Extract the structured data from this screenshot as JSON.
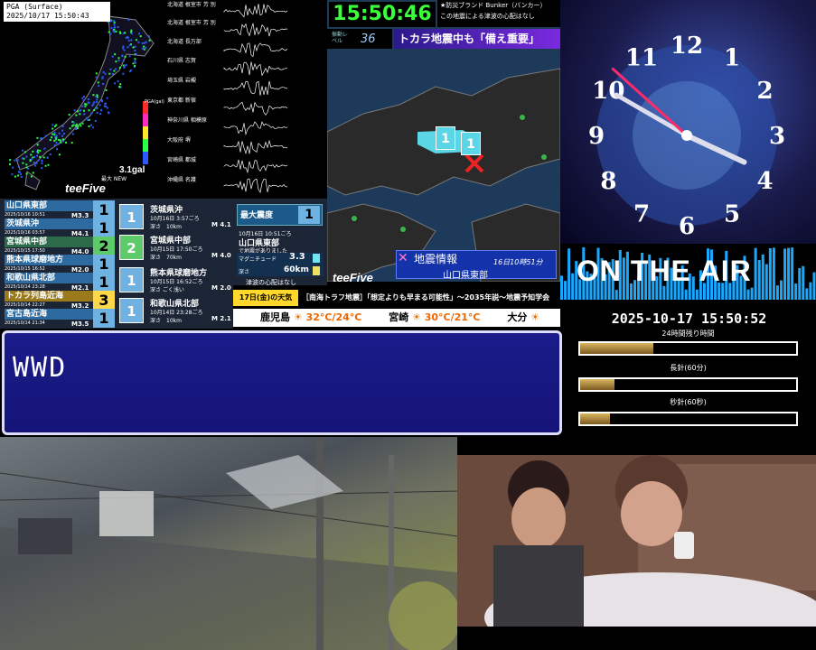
{
  "seismo": {
    "title_line1": "PGA (Surface)",
    "title_line2": "2025/10/17 15:50:43",
    "pga_value": "3.1gal",
    "peak_label": "最大 NEW",
    "pga_unit": "PGA(gal)",
    "brand": "teeFive",
    "stations": [
      "北海道 根室市 芳 別",
      "北海道 根室市 芳 別",
      "北海道 長万部",
      "石川県 志賀",
      "埼玉県 岩槻",
      "東京都 新宿",
      "神奈川県 相模原",
      "大阪府 堺",
      "宮崎県 都城",
      "沖縄県 名護"
    ]
  },
  "clock_digital": "15:50:46",
  "bunker": {
    "line1": "★防災ブランド Bunker（バンカー）",
    "line2": "この地震による津波の心配はなし"
  },
  "level": {
    "label": "振動レベル",
    "value": "36"
  },
  "headline": "トカラ地震中も「備え重要」",
  "map_info": {
    "title": "地震情報",
    "date": "16日10時51分",
    "area": "山口県東部",
    "brand": "teeFive",
    "markers": [
      "1",
      "1"
    ]
  },
  "quake_list": [
    {
      "area": "山口県東部",
      "date": "2025/10/16 10:51",
      "mag": "M3.3",
      "int": "1",
      "color": "#6fb1e0",
      "bg": "#2d6aa0"
    },
    {
      "area": "茨城県沖",
      "date": "2025/10/16 03:57",
      "mag": "M4.1",
      "int": "1",
      "color": "#6fb1e0",
      "bg": "#2d6aa0"
    },
    {
      "area": "宮城県中部",
      "date": "2025/10/15 17:50",
      "mag": "M4.0",
      "int": "2",
      "color": "#5ecb6a",
      "bg": "#2d6a4a"
    },
    {
      "area": "熊本県球磨地方",
      "date": "2025/10/15 16:52",
      "mag": "M2.0",
      "int": "1",
      "color": "#6fb1e0",
      "bg": "#2d6aa0"
    },
    {
      "area": "和歌山県北部",
      "date": "2025/10/14 23:28",
      "mag": "M2.1",
      "int": "1",
      "color": "#6fb1e0",
      "bg": "#2d6aa0"
    },
    {
      "area": "トカラ列島近海",
      "date": "2025/10/14 22:27",
      "mag": "M3.2",
      "int": "3",
      "color": "#ffd84a",
      "bg": "#9a7a1a"
    },
    {
      "area": "宮古島近海",
      "date": "2025/10/14 21:34",
      "mag": "M3.5",
      "int": "1",
      "color": "#6fb1e0",
      "bg": "#2d6aa0"
    }
  ],
  "quake_detail": [
    {
      "area": "茨城県沖",
      "date": "10月16日 3:57ごろ",
      "depth": "深さ　10km",
      "mag": "M 4.1",
      "int": "1"
    },
    {
      "area": "宮城県中部",
      "date": "10月15日 17:50ごろ",
      "depth": "深さ　70km",
      "mag": "M 4.0",
      "int": "2"
    },
    {
      "area": "熊本県球磨地方",
      "date": "10月15日 16:52ごろ",
      "depth": "深さ ごく浅い",
      "mag": "M 2.0",
      "int": "1"
    },
    {
      "area": "和歌山県北部",
      "date": "10月14日 23:28ごろ",
      "depth": "深さ　10km",
      "mag": "M 2.1",
      "int": "1"
    }
  ],
  "max_shindo": {
    "label": "最大震度",
    "value": "1",
    "date": "10月16日 10:51ごろ",
    "area": "山口県東部",
    "sub": "で地震がありました",
    "mag_label": "マグニチュード",
    "mag": "3.3",
    "depth_label": "深さ",
    "depth": "60km",
    "tsunami": "津波の心配はなし"
  },
  "ticker": {
    "tag": "17日(金)の天気",
    "news": "［南海トラフ地震］「想定よりも早まる可能性」〜2035年説〜地震予知学会"
  },
  "weather": [
    {
      "city": "鹿児島",
      "temp": "32°C/24°C"
    },
    {
      "city": "宮崎",
      "temp": "30°C/21°C"
    },
    {
      "city": "大分",
      "temp": ""
    }
  ],
  "wwd_text": "WWD",
  "analog_clock": {
    "hour": 3,
    "minute": 50,
    "second": 52,
    "numerals": [
      "12",
      "1",
      "2",
      "3",
      "4",
      "5",
      "6",
      "7",
      "8",
      "9",
      "10",
      "11"
    ]
  },
  "on_air": "ON THE AIR",
  "datetime": "2025-10-17 15:50:52",
  "progress": [
    {
      "label": "24時間残り時間",
      "value": 0.34
    },
    {
      "label": "長針(60分)",
      "value": 0.16
    },
    {
      "label": "秒針(60秒)",
      "value": 0.14
    }
  ]
}
